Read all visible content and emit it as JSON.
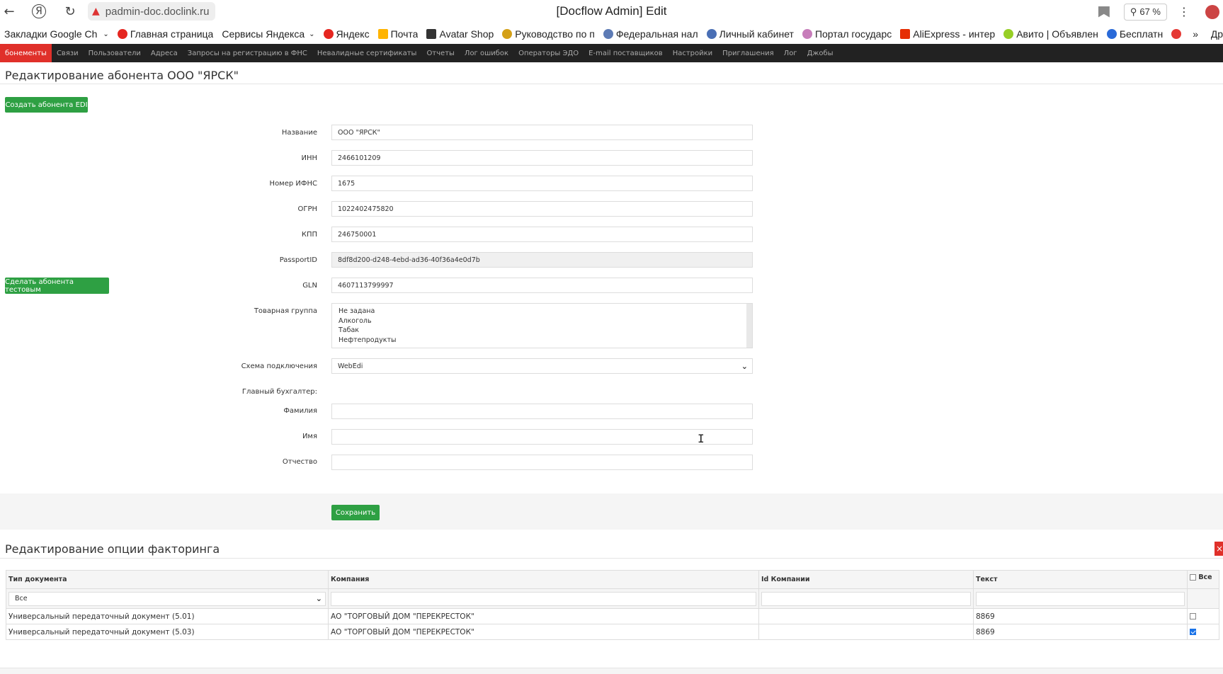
{
  "browser": {
    "url": "padmin-doc.doclink.ru",
    "title": "[Docflow Admin] Edit",
    "zoom": "67 %"
  },
  "bookmarks": [
    {
      "label": "Закладки Google Ch",
      "color": "#ffffff"
    },
    {
      "label": "Главная страница",
      "color": "#e52620"
    },
    {
      "label": "Сервисы Яндекса",
      "color": "#ffffff"
    },
    {
      "label": "Яндекс",
      "color": "#e52620"
    },
    {
      "label": "Почта",
      "color": "#ffb400"
    },
    {
      "label": "Avatar Shop",
      "color": "#333333"
    },
    {
      "label": "Руководство по п",
      "color": "#d4a017"
    },
    {
      "label": "Федеральная нал",
      "color": "#5d7bb5"
    },
    {
      "label": "Личный кабинет",
      "color": "#4a6fb5"
    },
    {
      "label": "Портал государс",
      "color": "#c77dba"
    },
    {
      "label": "AliExpress - интер",
      "color": "#e62e04"
    },
    {
      "label": "Авито | Объявлен",
      "color": "#97cf26"
    },
    {
      "label": "Бесплатн",
      "color": "#2a6ad8"
    }
  ],
  "bookmarks_more": "»",
  "bookmarks_right": "Др",
  "nav": [
    {
      "label": "бонементы",
      "active": true
    },
    {
      "label": "Связи"
    },
    {
      "label": "Пользователи"
    },
    {
      "label": "Адреса"
    },
    {
      "label": "Запросы на регистрацию в ФНС"
    },
    {
      "label": "Невалидные сертификаты"
    },
    {
      "label": "Отчеты"
    },
    {
      "label": "Лог ошибок"
    },
    {
      "label": "Операторы ЭДО"
    },
    {
      "label": "E-mail поставщиков"
    },
    {
      "label": "Настройки"
    },
    {
      "label": "Приглашения"
    },
    {
      "label": "Лог"
    },
    {
      "label": "Джобы"
    }
  ],
  "page_heading": "Редактирование абонента ООО \"ЯРСК\"",
  "buttons": {
    "create_edi": "Создать абонента EDI",
    "make_test": "Сделать абонента тестовым",
    "save": "Сохранить"
  },
  "form": {
    "name_label": "Название",
    "name_value": "ООО \"ЯРСК\"",
    "inn_label": "ИНН",
    "inn_value": "2466101209",
    "ifns_label": "Номер ИФНС",
    "ifns_value": "1675",
    "ogrn_label": "ОГРН",
    "ogrn_value": "1022402475820",
    "kpp_label": "КПП",
    "kpp_value": "246750001",
    "passport_label": "PassportID",
    "passport_value": "8df8d200-d248-4ebd-ad36-40f36a4e0d7b",
    "gln_label": "GLN",
    "gln_value": "4607113799997",
    "group_label": "Товарная группа",
    "group_options": [
      "Не задана",
      "Алкоголь",
      "Табак",
      "Нефтепродукты"
    ],
    "scheme_label": "Схема подключения",
    "scheme_value": "WebEdi",
    "accountant_label": "Главный бухгалтер:",
    "lastname_label": "Фамилия",
    "lastname_value": "",
    "firstname_label": "Имя",
    "firstname_value": "",
    "patronymic_label": "Отчество",
    "patronymic_value": ""
  },
  "factoring": {
    "heading": "Редактирование опции факторинга",
    "close": "×",
    "columns": [
      "Тип документа",
      "Компания",
      "Id Компании",
      "Текст",
      "Все"
    ],
    "filter_doc_type": "Все",
    "rows": [
      {
        "doc_type": "Универсальный передаточный документ (5.01)",
        "company": "АО \"ТОРГОВЫЙ ДОМ \"ПЕРЕКРЕСТОК\"",
        "company_id": "",
        "text": "8869",
        "checked": false
      },
      {
        "doc_type": "Универсальный передаточный документ (5.03)",
        "company": "АО \"ТОРГОВЫЙ ДОМ \"ПЕРЕКРЕСТОК\"",
        "company_id": "",
        "text": "8869",
        "checked": true
      }
    ]
  }
}
